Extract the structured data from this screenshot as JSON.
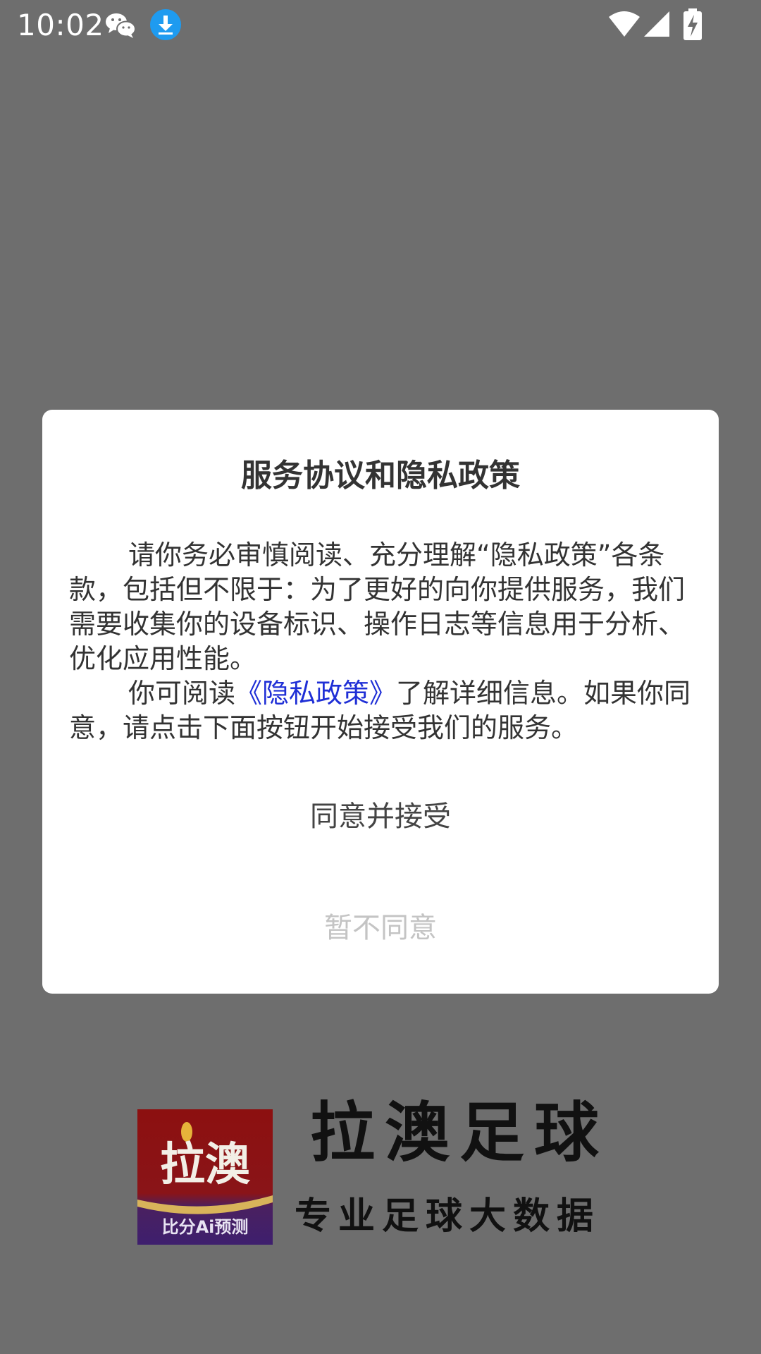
{
  "status_bar": {
    "time": "10:02",
    "icons": [
      "wechat-icon",
      "download-icon",
      "wifi-icon",
      "signal-icon",
      "battery-charging-icon"
    ],
    "download_icon_color": "#1e9bf0"
  },
  "dialog": {
    "title": "服务协议和隐私政策",
    "paragraph1": "请你务必审慎阅读、充分理解“隐私政策”各条款，包括但不限于：为了更好的向你提供服务，我们需要收集你的设备标识、操作日志等信息用于分析、优化应用性能。",
    "paragraph2_prefix": "你可阅读",
    "privacy_link": "《隐私政策》",
    "paragraph2_suffix": "了解详细信息。如果你同意，请点击下面按钮开始接受我们的服务。",
    "accept_label": "同意并接受",
    "decline_label": "暂不同意",
    "link_color": "#1f2fd6"
  },
  "branding": {
    "logo_text": "拉澳",
    "logo_tagline": "比分Ai预测",
    "title": "拉澳足球",
    "subtitle": "专业足球大数据",
    "logo_colors": [
      "#8c1010",
      "#3e1f6e",
      "#d8b35a"
    ]
  }
}
